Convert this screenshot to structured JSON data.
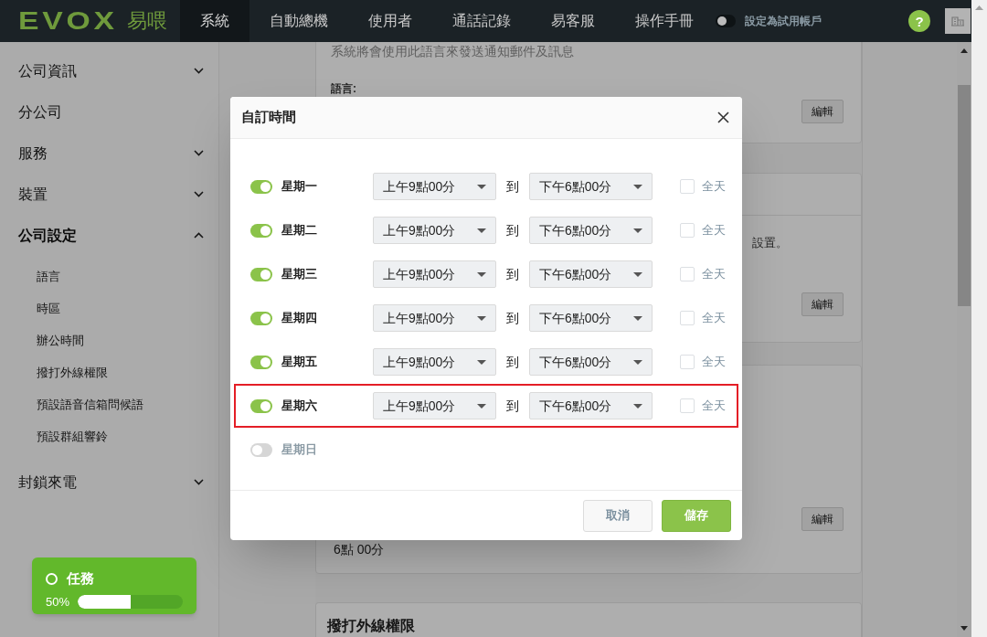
{
  "header": {
    "logo": {
      "brand": "EVOX",
      "sub": "易喂"
    },
    "nav": [
      {
        "label": "系統",
        "selected": true
      },
      {
        "label": "自動總機",
        "selected": false
      },
      {
        "label": "使用者",
        "selected": false
      },
      {
        "label": "通話記錄",
        "selected": false
      },
      {
        "label": "易客服",
        "selected": false
      },
      {
        "label": "操作手冊",
        "selected": false
      }
    ],
    "trial_toggle": {
      "label": "設定為試用帳戶",
      "on": false
    },
    "help": "?"
  },
  "sidebar": {
    "items": [
      {
        "label": "公司資訊",
        "expandable": true,
        "expanded": false
      },
      {
        "label": "分公司",
        "expandable": false,
        "expanded": false
      },
      {
        "label": "服務",
        "expandable": true,
        "expanded": false
      },
      {
        "label": "裝置",
        "expandable": true,
        "expanded": false
      },
      {
        "label": "公司設定",
        "expandable": true,
        "expanded": true,
        "children": [
          {
            "label": "語言"
          },
          {
            "label": "時區"
          },
          {
            "label": "辦公時間"
          },
          {
            "label": "撥打外線權限"
          },
          {
            "label": "預設語音信箱問候語"
          },
          {
            "label": "預設群組響鈴"
          }
        ]
      },
      {
        "label": "封鎖來電",
        "expandable": true,
        "expanded": false
      }
    ]
  },
  "background": {
    "cards": [
      {
        "description": "系統將會使用此語言來發送通知郵件及訊息",
        "field_label": "語言:",
        "edit_button": "編輯"
      },
      {
        "partial_text": "設置。",
        "edit_button": "編輯"
      },
      {
        "value_text": "6點 00分",
        "edit_button": "編輯"
      },
      {
        "title": "撥打外線權限"
      }
    ]
  },
  "dialog": {
    "title": "自訂時間",
    "days": [
      {
        "name": "星期一",
        "on": true,
        "start": "上午9點00分",
        "to": "到",
        "end": "下午6點00分",
        "all_day_label": "全天",
        "all_day": false,
        "highlighted": false
      },
      {
        "name": "星期二",
        "on": true,
        "start": "上午9點00分",
        "to": "到",
        "end": "下午6點00分",
        "all_day_label": "全天",
        "all_day": false,
        "highlighted": false
      },
      {
        "name": "星期三",
        "on": true,
        "start": "上午9點00分",
        "to": "到",
        "end": "下午6點00分",
        "all_day_label": "全天",
        "all_day": false,
        "highlighted": false
      },
      {
        "name": "星期四",
        "on": true,
        "start": "上午9點00分",
        "to": "到",
        "end": "下午6點00分",
        "all_day_label": "全天",
        "all_day": false,
        "highlighted": false
      },
      {
        "name": "星期五",
        "on": true,
        "start": "上午9點00分",
        "to": "到",
        "end": "下午6點00分",
        "all_day_label": "全天",
        "all_day": false,
        "highlighted": false
      },
      {
        "name": "星期六",
        "on": true,
        "start": "上午9點00分",
        "to": "到",
        "end": "下午6點00分",
        "all_day_label": "全天",
        "all_day": false,
        "highlighted": true
      },
      {
        "name": "星期日",
        "on": false,
        "highlighted": false
      }
    ],
    "cancel": "取消",
    "save": "儲存"
  },
  "task_widget": {
    "title": "任務",
    "percent": "50%",
    "level": 0.5
  }
}
